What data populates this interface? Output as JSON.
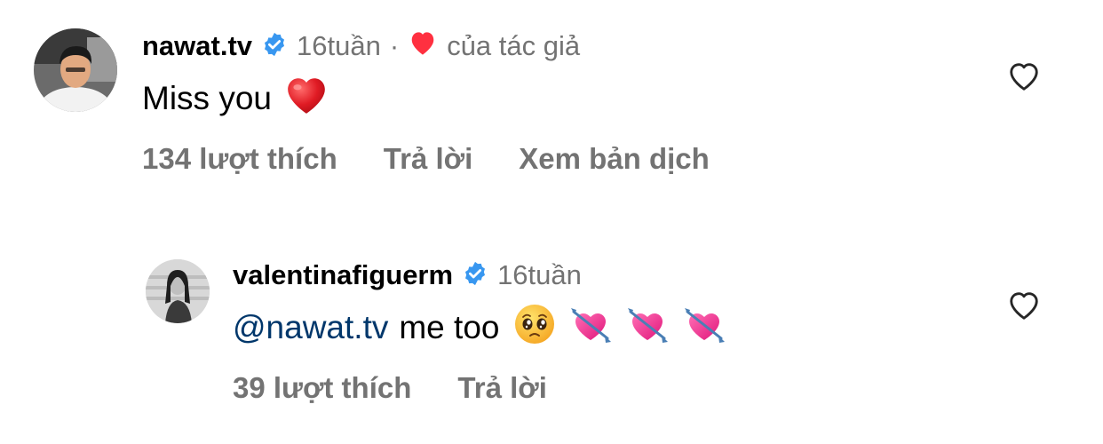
{
  "comments": [
    {
      "username": "nawat.tv",
      "time": "16tuần",
      "author_like_label": "của tác giả",
      "text": "Miss you",
      "likes": "134 lượt thích",
      "reply": "Trả lời",
      "translate": "Xem bản dịch",
      "emoji": [
        "red-heart"
      ]
    },
    {
      "username": "valentinafiguerm",
      "time": "16tuần",
      "mention": "@nawat.tv",
      "text": "me too",
      "likes": "39 lượt thích",
      "reply": "Trả lời",
      "emoji": [
        "pleading-face",
        "heart-with-arrow",
        "heart-with-arrow",
        "heart-with-arrow"
      ]
    }
  ],
  "colors": {
    "verified": "#3897f0",
    "meta": "#737373",
    "mention": "#00376b",
    "red": "#ff3040"
  }
}
